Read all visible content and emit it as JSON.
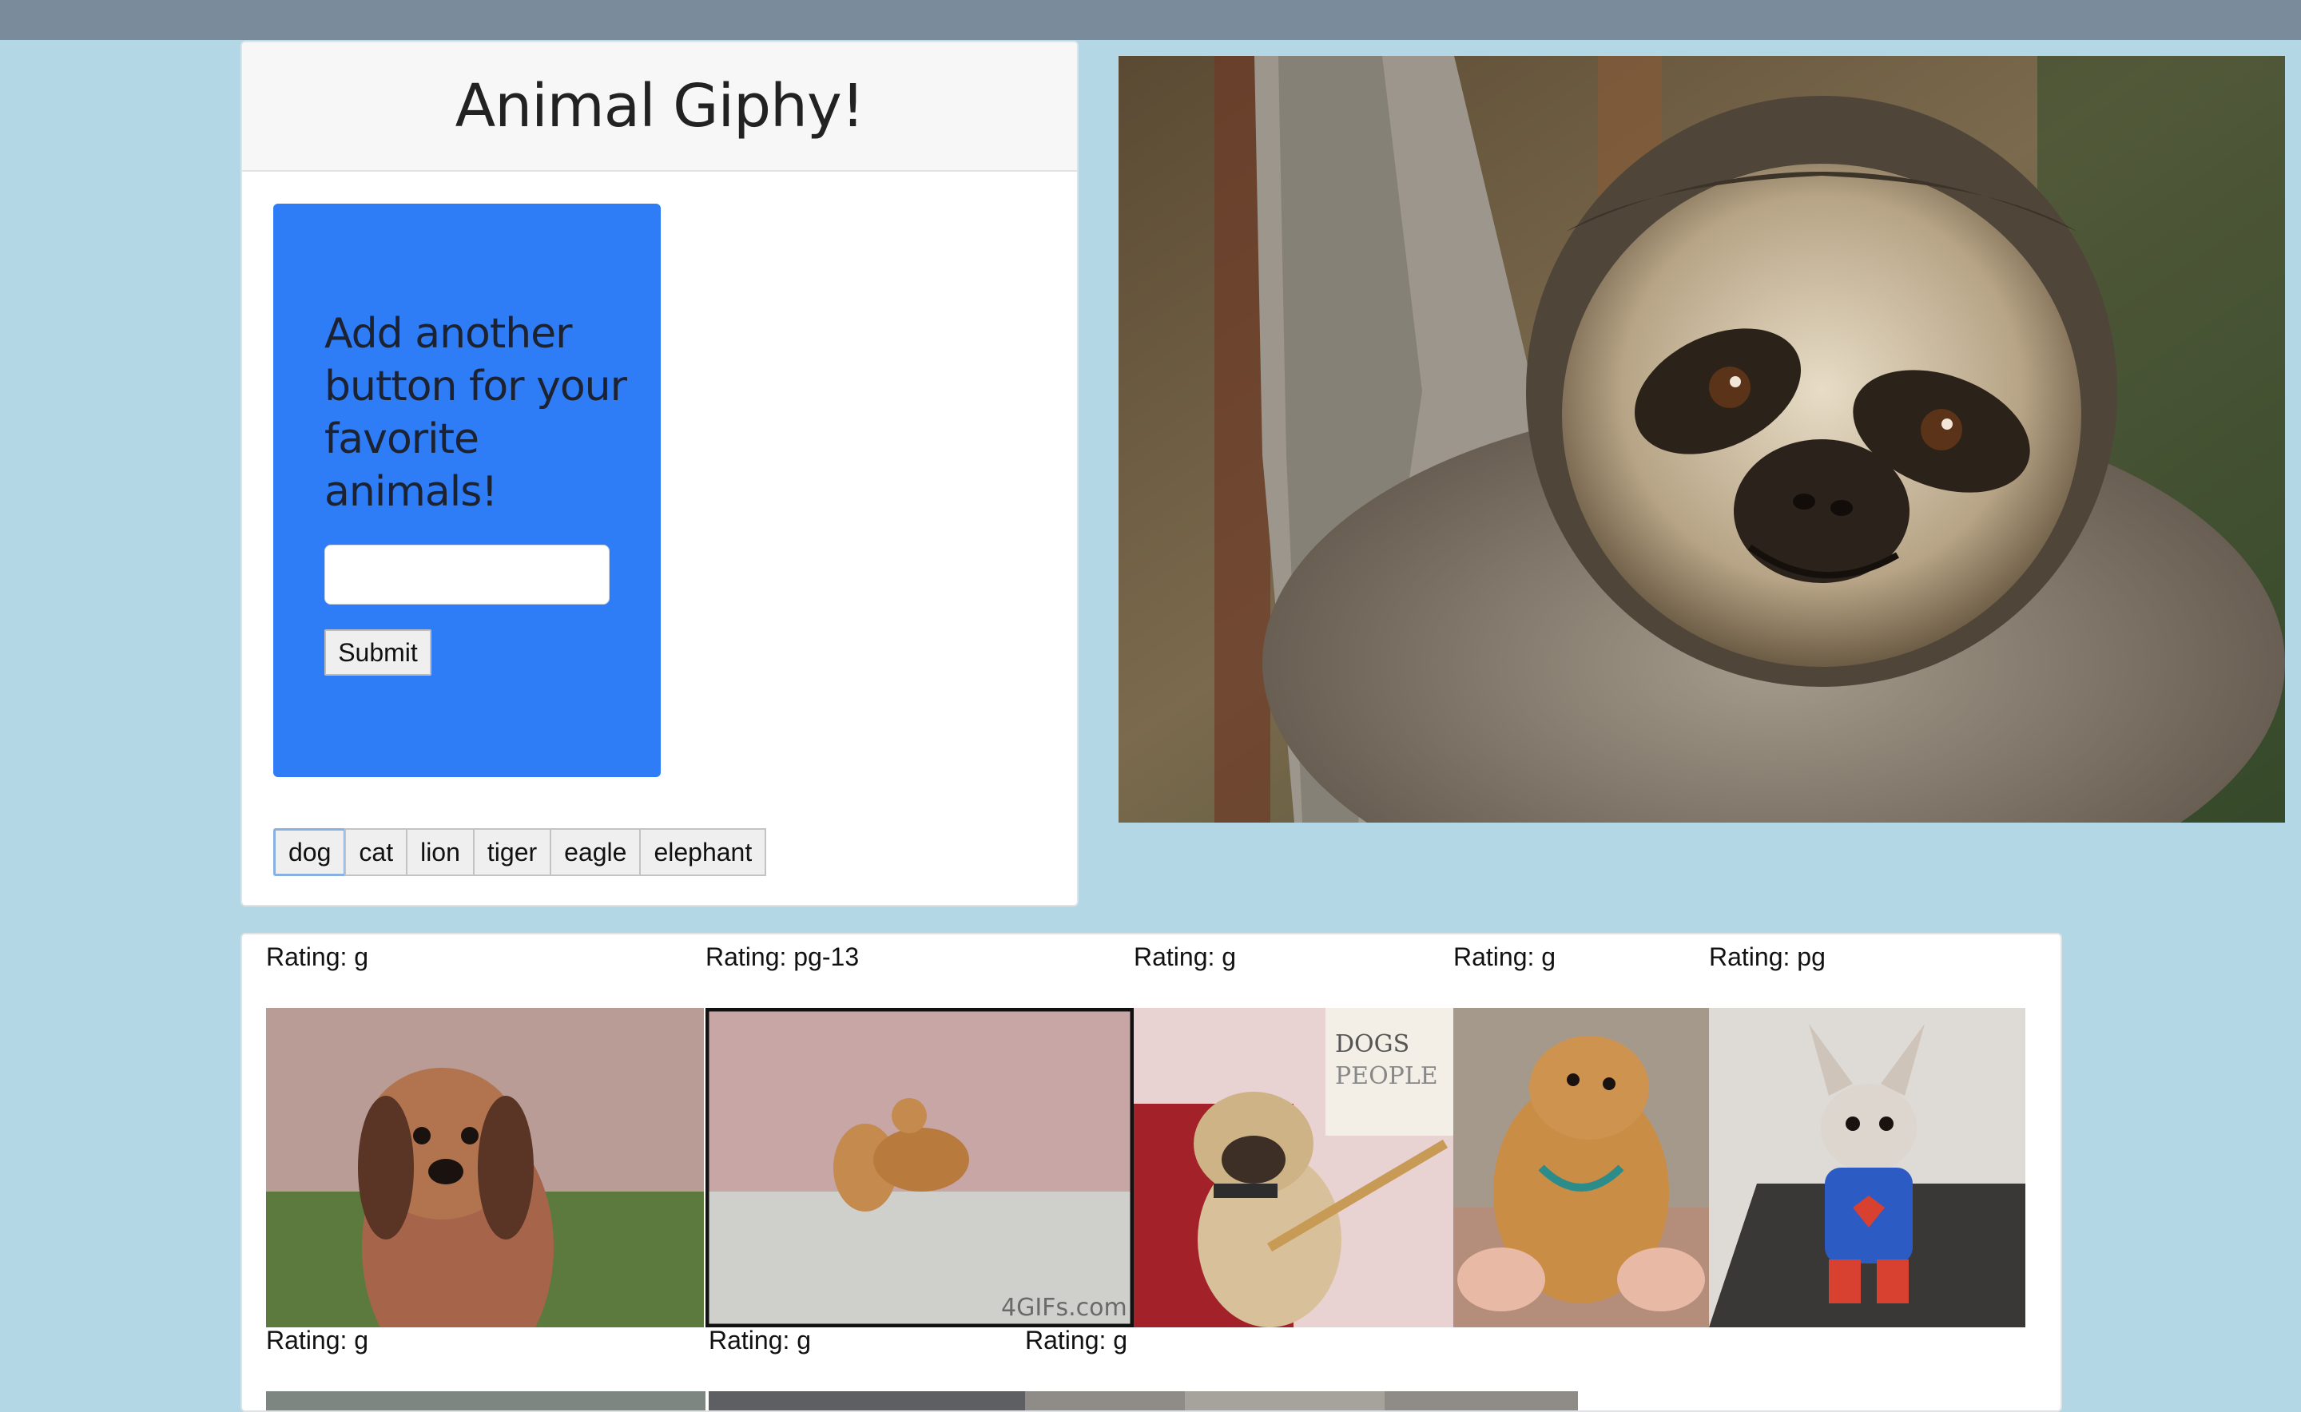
{
  "header": {
    "title": "Animal Giphy!"
  },
  "form": {
    "prompt": "Add another button for your favorite animals!",
    "input_value": "",
    "input_placeholder": "",
    "submit_label": "Submit"
  },
  "animal_buttons": [
    "dog",
    "cat",
    "lion",
    "tiger",
    "eagle",
    "elephant"
  ],
  "hero": {
    "subject": "sloth",
    "icon": "sloth-image"
  },
  "results": {
    "gifs": [
      {
        "rating": "Rating: g",
        "subject": "smiling-dachshund"
      },
      {
        "rating": "Rating: pg-13",
        "subject": "two-chihuahuas",
        "watermark": "4GIFs.com"
      },
      {
        "rating": "Rating: g",
        "subject": "pug-with-bowtie"
      },
      {
        "rating": "Rating: g",
        "subject": "puppy-on-back"
      },
      {
        "rating": "Rating: pg",
        "subject": "chihuahua-superman-costume"
      },
      {
        "rating": "Rating: g",
        "subject": "partial-gif"
      },
      {
        "rating": "Rating: g",
        "subject": "partial-gif"
      },
      {
        "rating": "Rating: g",
        "subject": "partial-gif"
      }
    ]
  },
  "colors": {
    "page_bg": "#b3d7e4",
    "topbar": "#7a8b9b",
    "panel_blue": "#2e7df6"
  }
}
